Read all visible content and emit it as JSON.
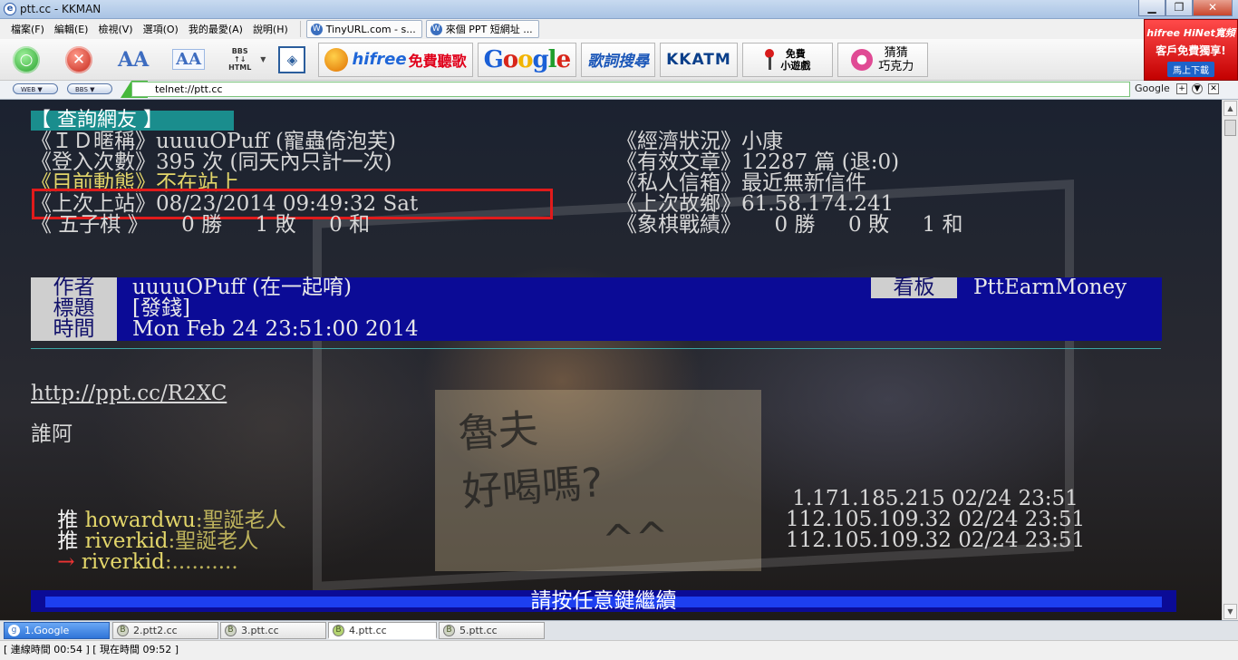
{
  "window": {
    "title": "ptt.cc - KKMAN",
    "app_icon": "e-icon",
    "min_glyph": "▁",
    "max_glyph": "❐",
    "close_glyph": "✕"
  },
  "menu": {
    "items": [
      "檔案(F)",
      "編輯(E)",
      "檢視(V)",
      "選項(O)",
      "我的最愛(A)",
      "說明(H)"
    ],
    "tabs": [
      {
        "icon": "W",
        "label": "TinyURL.com - s..."
      },
      {
        "icon": "W",
        "label": "來個 PPT 短網址 ..."
      }
    ]
  },
  "toolbar": {
    "go_glyph": "○",
    "stop_glyph": "✕",
    "font_larger": "AA",
    "font_smaller": "AA",
    "bbs_html_top": "BBS",
    "bbs_html_mid": "↑↓",
    "bbs_html_bot": "HTML",
    "caret": "▼",
    "box_glyph": "◈",
    "hifree_word": "hifree",
    "hifree_sub": "免費聽歌",
    "google_letters": [
      "G",
      "o",
      "o",
      "g",
      "l",
      "e"
    ],
    "google_colors": [
      "#1a5fd6",
      "#d8261a",
      "#f2b400",
      "#1a5fd6",
      "#1f9d2c",
      "#d8261a"
    ],
    "lyrics_label": "歌詞搜尋",
    "kkatm_label": "KKATM",
    "game_label_1": "免費",
    "game_label_2": "小遊戲",
    "choc_label_1": "猜猜",
    "choc_label_2": "巧克力"
  },
  "ad": {
    "line1": "hifree HiNet寬頻",
    "line2": "客戶免費獨享!",
    "line3": "馬上下載"
  },
  "address": {
    "web_btn": "WEB ▼",
    "bbs_btn": "BBS ▼",
    "url": "telnet://ptt.cc",
    "search_engine": "Google",
    "mini_add": "+",
    "mini_down": "▼",
    "mini_close": "✕"
  },
  "terminal": {
    "query_header": "【 查詢網友 】",
    "id_line": "《ＩＤ暱稱》uuuuOPuff (寵蟲倚泡芙)",
    "economy_line": "《經濟狀況》小康",
    "login_line": "《登入次數》395 次 (同天內只計一次)",
    "posts_line": "《有效文章》12287 篇 (退:0)",
    "status_line_label": "《目前動態》",
    "status_line_value": "不在站上",
    "mail_line": "《私人信箱》最近無新信件",
    "last_login_line": "《上次上站》08/23/2014 09:49:32 Sat",
    "last_ip_line": "《上次故鄉》61.58.174.241",
    "gomoku_line": "《 五子棋 》     0 勝     1 敗     0 和",
    "chess_line": "《象棋戰績》     0 勝     0 敗     1 和",
    "author_label": "作者",
    "title_label": "標題",
    "time_label": "時間",
    "board_label": "看板",
    "author_value": "uuuuOPuff (在一起唷)",
    "title_value": "[發錢]",
    "time_value": "Mon Feb 24 23:51:00 2014",
    "board_value": "PttEarnMoney",
    "link": "http://ppt.cc/R2XC",
    "body_text": "誰阿",
    "pushes": [
      {
        "prefix": "推",
        "user": "howardwu",
        "content": ":聖誕老人",
        "meta": " 1.171.185.215 02/24 23:51"
      },
      {
        "prefix": "推",
        "user": "riverkid",
        "content": ":聖誕老人",
        "meta": "112.105.109.32 02/24 23:51"
      },
      {
        "prefix": "→",
        "user": "riverkid",
        "content": ":..........",
        "meta": "112.105.109.32 02/24 23:51"
      }
    ],
    "press_any_key": "請按任意鍵繼續",
    "photo_note": "魯夫\n好喝嗎?\n^^"
  },
  "scroll": {
    "up": "▲",
    "down": "▼"
  },
  "tabs": [
    {
      "label": "1.Google",
      "icon": "g"
    },
    {
      "label": "2.ptt2.cc",
      "icon": "B"
    },
    {
      "label": "3.ptt.cc",
      "icon": "B"
    },
    {
      "label": "4.ptt.cc",
      "icon": "B"
    },
    {
      "label": "5.ptt.cc",
      "icon": "B"
    }
  ],
  "status": {
    "text": "[ 連線時間 00:54 ] [ 現在時間 09:52 ]"
  },
  "colors": {
    "terminal_blue": "#0b0b96",
    "highlight_red": "#e01b1b",
    "cyan": "#1a8d8d"
  }
}
